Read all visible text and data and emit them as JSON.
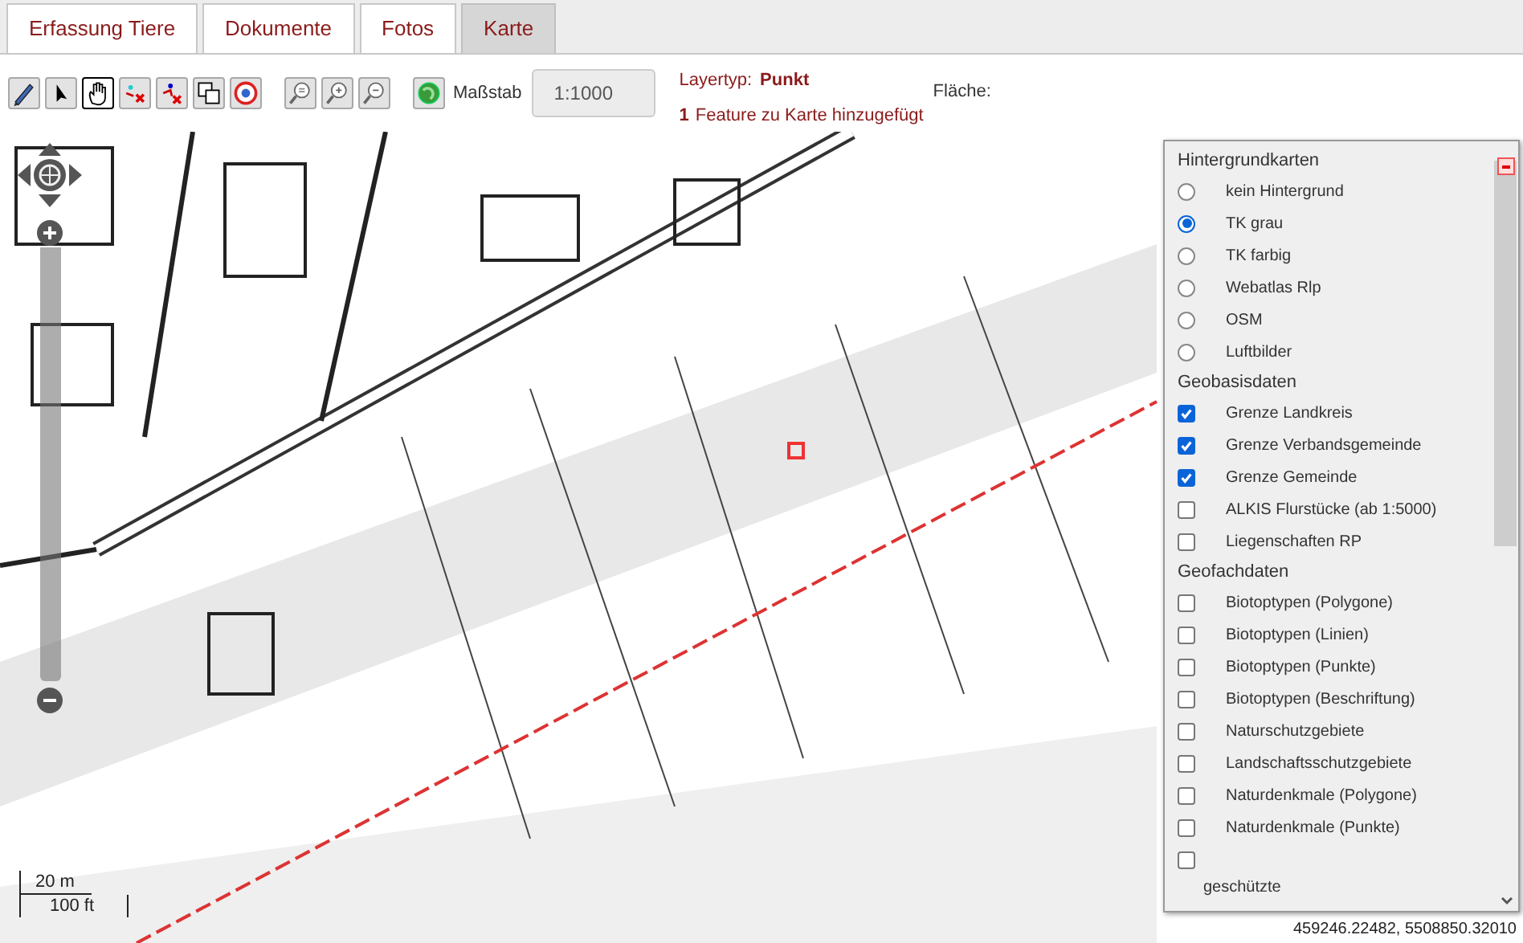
{
  "tabs": [
    {
      "label": "Erfassung Tiere",
      "selected": false
    },
    {
      "label": "Dokumente",
      "selected": false
    },
    {
      "label": "Fotos",
      "selected": false
    },
    {
      "label": "Karte",
      "selected": true
    }
  ],
  "toolbar": {
    "tools": [
      {
        "kind": "pencil",
        "selected": false
      },
      {
        "kind": "pointer",
        "selected": false
      },
      {
        "kind": "hand",
        "selected": true
      },
      {
        "kind": "delete-node",
        "selected": false
      },
      {
        "kind": "delete-vertex",
        "selected": false
      },
      {
        "kind": "copy",
        "selected": false
      },
      {
        "kind": "target",
        "selected": false
      },
      {
        "kind": "zoom-box",
        "selected": false
      },
      {
        "kind": "zoom-in",
        "selected": false
      },
      {
        "kind": "zoom-out",
        "selected": false
      },
      {
        "kind": "globe",
        "selected": false
      }
    ],
    "scale_label": "Maßstab",
    "scale_value": "1:1000",
    "layer_type_label": "Layertyp:",
    "layer_type": "Punkt",
    "feature_count": "1",
    "feature_message": "Feature zu Karte hinzugefügt",
    "area_label": "Fläche:"
  },
  "layer_panel": {
    "sections": [
      {
        "title": "Hintergrundkarten",
        "items": [
          {
            "kind": "radio",
            "label": "kein Hintergrund",
            "checked": false
          },
          {
            "kind": "radio",
            "label": "TK grau",
            "checked": true
          },
          {
            "kind": "radio",
            "label": "TK farbig",
            "checked": false
          },
          {
            "kind": "radio",
            "label": "Webatlas Rlp",
            "checked": false
          },
          {
            "kind": "radio",
            "label": "OSM",
            "checked": false
          },
          {
            "kind": "radio",
            "label": "Luftbilder",
            "checked": false
          }
        ]
      },
      {
        "title": "Geobasisdaten",
        "items": [
          {
            "kind": "checkbox",
            "label": "Grenze Landkreis",
            "checked": true
          },
          {
            "kind": "checkbox",
            "label": "Grenze Verbandsgemeinde",
            "checked": true
          },
          {
            "kind": "checkbox",
            "label": "Grenze Gemeinde",
            "checked": true
          },
          {
            "kind": "checkbox",
            "label": "ALKIS Flurstücke (ab 1:5000)",
            "checked": false
          },
          {
            "kind": "checkbox",
            "label": "Liegenschaften RP",
            "checked": false
          }
        ]
      },
      {
        "title": "Geofachdaten",
        "items": [
          {
            "kind": "checkbox",
            "label": "Biotoptypen (Polygone)",
            "checked": false
          },
          {
            "kind": "checkbox",
            "label": "Biotoptypen (Linien)",
            "checked": false
          },
          {
            "kind": "checkbox",
            "label": "Biotoptypen (Punkte)",
            "checked": false
          },
          {
            "kind": "checkbox",
            "label": "Biotoptypen (Beschriftung)",
            "checked": false
          },
          {
            "kind": "checkbox",
            "label": "Naturschutzgebiete",
            "checked": false
          },
          {
            "kind": "checkbox",
            "label": "Landschaftsschutzgebiete",
            "checked": false
          },
          {
            "kind": "checkbox",
            "label": "Naturdenkmale (Polygone)",
            "checked": false
          },
          {
            "kind": "checkbox",
            "label": "Naturdenkmale (Punkte)",
            "checked": false
          },
          {
            "kind": "checkbox-wrapped",
            "label": "geschützte",
            "checked": false
          }
        ]
      }
    ]
  },
  "map": {
    "scale_metric": "20 m",
    "scale_imperial": "100 ft",
    "coordinates": "459246.22482, 5508850.32010"
  }
}
